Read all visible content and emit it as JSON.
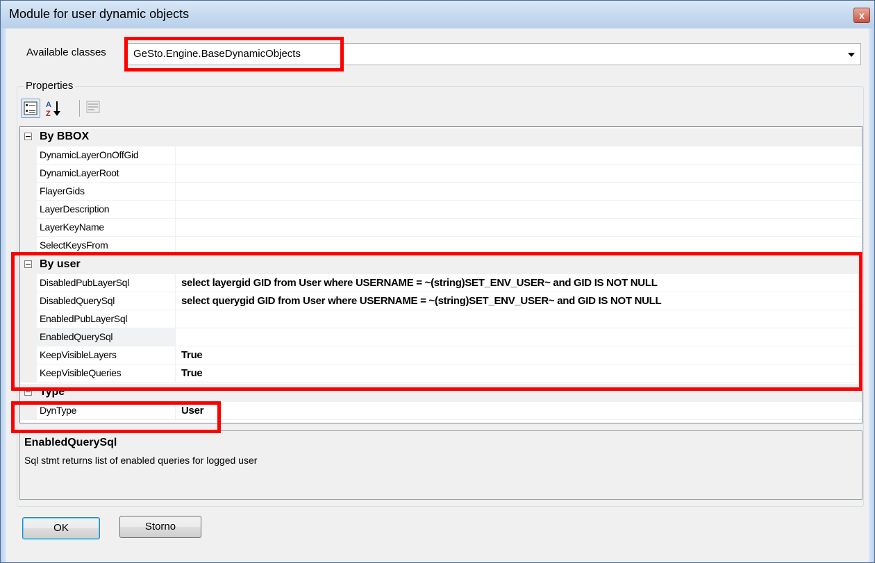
{
  "window": {
    "title": "Module for user dynamic objects",
    "close_glyph": "x"
  },
  "classes": {
    "label": "Available classes",
    "selected": "GeSto.Engine.BaseDynamicObjects"
  },
  "properties": {
    "group_label": "Properties",
    "categories": [
      {
        "name": "By BBOX",
        "items": [
          {
            "name": "DynamicLayerOnOffGid",
            "value": ""
          },
          {
            "name": "DynamicLayerRoot",
            "value": ""
          },
          {
            "name": "FlayerGids",
            "value": ""
          },
          {
            "name": "LayerDescription",
            "value": ""
          },
          {
            "name": "LayerKeyName",
            "value": ""
          },
          {
            "name": "SelectKeysFrom",
            "value": ""
          }
        ]
      },
      {
        "name": "By user",
        "items": [
          {
            "name": "DisabledPubLayerSql",
            "value": "select layergid GID from User where USERNAME = ~(string)SET_ENV_USER~ and GID IS NOT NULL"
          },
          {
            "name": "DisabledQuerySql",
            "value": "select querygid GID from User where USERNAME = ~(string)SET_ENV_USER~ and GID IS NOT NULL"
          },
          {
            "name": "EnabledPubLayerSql",
            "value": ""
          },
          {
            "name": "EnabledQuerySql",
            "value": ""
          },
          {
            "name": "KeepVisibleLayers",
            "value": "True"
          },
          {
            "name": "KeepVisibleQueries",
            "value": "True"
          }
        ]
      },
      {
        "name": "Type",
        "items": [
          {
            "name": "DynType",
            "value": "User"
          }
        ]
      }
    ]
  },
  "description": {
    "title": "EnabledQuerySql",
    "text": "Sql stmt returns list of enabled queries for logged user"
  },
  "buttons": {
    "ok": "OK",
    "cancel": "Storno"
  },
  "colors": {
    "highlight": "#ff0000",
    "title_bar": "#c8dbf0"
  }
}
